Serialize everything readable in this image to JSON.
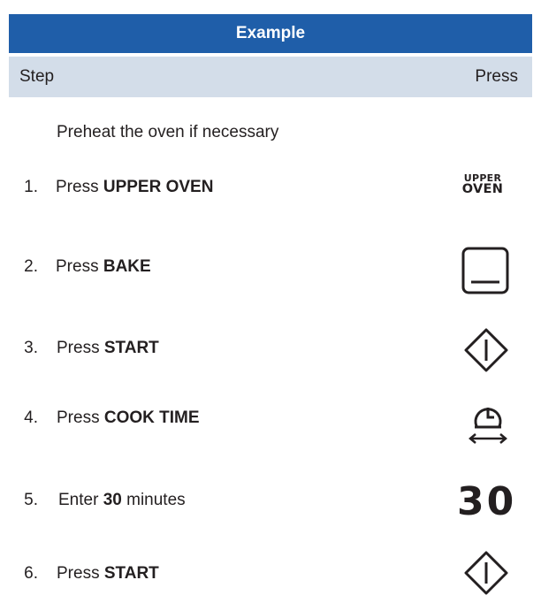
{
  "header": {
    "title": "Example"
  },
  "columns": {
    "step": "Step",
    "press": "Press"
  },
  "intro": "Preheat the oven if necessary",
  "steps": [
    {
      "number": "1.",
      "prefix": "Press ",
      "bold": "UPPER OVEN",
      "suffix": "",
      "icon": "upper-oven-icon"
    },
    {
      "number": "2.",
      "prefix": "Press ",
      "bold": "BAKE",
      "suffix": "",
      "icon": "bake-icon"
    },
    {
      "number": "3.",
      "prefix": "Press ",
      "bold": "START",
      "suffix": "",
      "icon": "start-icon"
    },
    {
      "number": "4.",
      "prefix": "Press ",
      "bold": "COOK TIME",
      "suffix": "",
      "icon": "cook-time-icon"
    },
    {
      "number": "5.",
      "prefix": "Enter ",
      "bold": "30",
      "suffix": " minutes",
      "icon": "thirty-display"
    },
    {
      "number": "6.",
      "prefix": "Press ",
      "bold": "START",
      "suffix": "",
      "icon": "start-icon"
    }
  ],
  "icons": {
    "upper_oven": {
      "line1": "UPPER",
      "line2": "OVEN"
    },
    "thirty": "30"
  },
  "colors": {
    "header_bg": "#1f5ea9",
    "subheader_bg": "#d3dde9",
    "text": "#231f20"
  }
}
